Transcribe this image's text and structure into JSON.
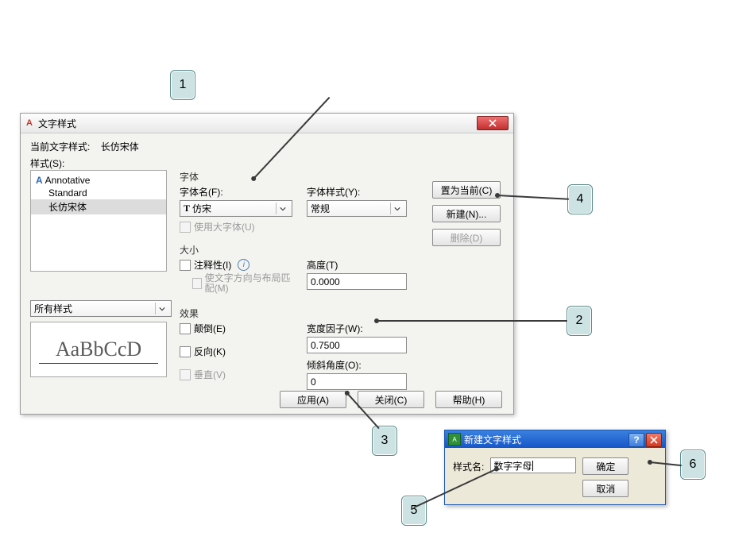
{
  "main_dialog": {
    "title": "文字样式",
    "current_style_label": "当前文字样式:",
    "current_style_value": "长仿宋体",
    "styles_label": "样式(S):",
    "style_list": [
      "Annotative",
      "Standard",
      "长仿宋体"
    ],
    "filter_label": "所有样式",
    "preview_text": "AaBbCcD",
    "font_section": "字体",
    "font_name_label": "字体名(F):",
    "font_name_value": "仿宋",
    "font_style_label": "字体样式(Y):",
    "font_style_value": "常规",
    "use_bigfont": "使用大字体(U)",
    "size_section": "大小",
    "annotative_label": "注释性(I)",
    "match_orient": "使文字方向与布局匹配(M)",
    "height_label": "高度(T)",
    "height_value": "0.0000",
    "effects_section": "效果",
    "upside_down": "颠倒(E)",
    "backwards": "反向(K)",
    "vertical": "垂直(V)",
    "width_factor_label": "宽度因子(W):",
    "width_factor_value": "0.7500",
    "oblique_label": "倾斜角度(O):",
    "oblique_value": "0",
    "btn_set_current": "置为当前(C)",
    "btn_new": "新建(N)...",
    "btn_delete": "删除(D)",
    "btn_apply": "应用(A)",
    "btn_close": "关闭(C)",
    "btn_help": "帮助(H)"
  },
  "new_dialog": {
    "title": "新建文字样式",
    "name_label": "样式名:",
    "name_value": "数字字母",
    "btn_ok": "确定",
    "btn_cancel": "取消"
  },
  "callouts": {
    "c1": "1",
    "c2": "2",
    "c3": "3",
    "c4": "4",
    "c5": "5",
    "c6": "6"
  }
}
